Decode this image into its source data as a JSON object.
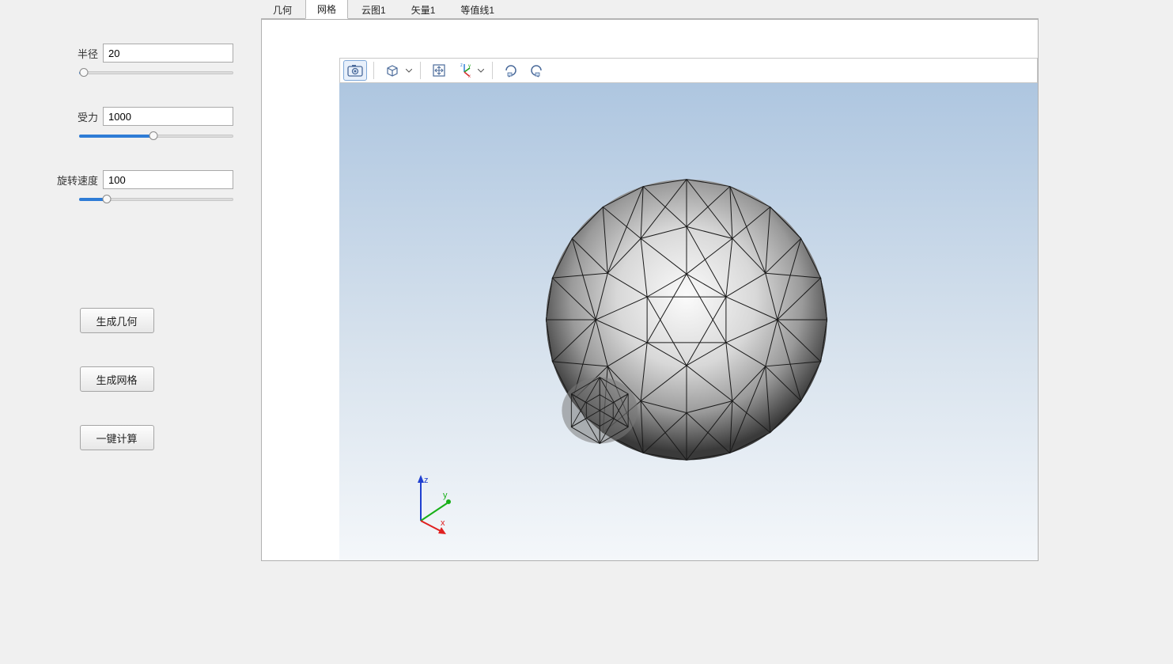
{
  "params": {
    "radius": {
      "label": "半径",
      "value": "20",
      "slider_percent": 3
    },
    "force": {
      "label": "受力",
      "value": "1000",
      "slider_percent": 48
    },
    "speed": {
      "label": "旋转速度",
      "value": "100",
      "slider_percent": 18
    }
  },
  "buttons": {
    "gen_geometry": "生成几何",
    "gen_mesh": "生成网格",
    "compute": "一键计算"
  },
  "tabs": [
    {
      "label": "几何",
      "active": false
    },
    {
      "label": "网格",
      "active": true
    },
    {
      "label": "云图1",
      "active": false
    },
    {
      "label": "矢量1",
      "active": false
    },
    {
      "label": "等值线1",
      "active": false
    }
  ],
  "toolbar": {
    "snapshot_icon": "snapshot",
    "projection_icon": "projection",
    "fit_icon": "fit-to-view",
    "axes_icon": "axis-orientation",
    "rotate_cw_icon": "rotate-cw",
    "rotate_ccw_icon": "rotate-ccw"
  },
  "axes": {
    "x": "x",
    "y": "y",
    "z": "z"
  }
}
